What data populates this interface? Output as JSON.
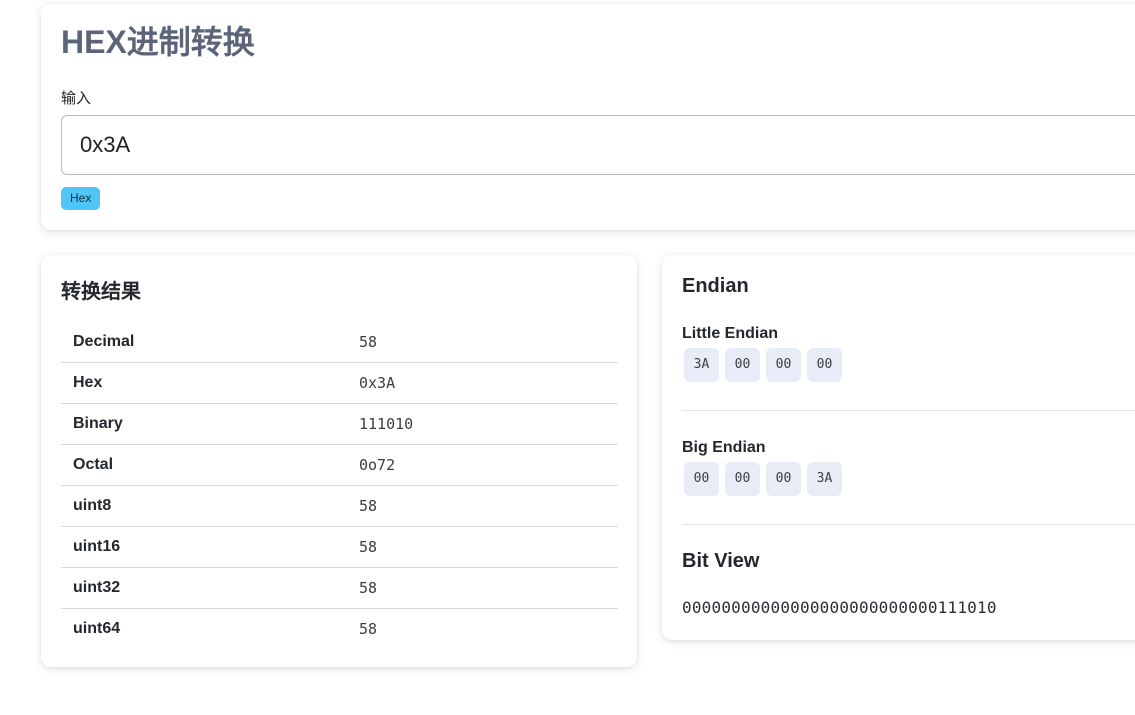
{
  "header": {
    "title": "HEX进制转换",
    "input_label": "输入",
    "input_value": "0x3A",
    "badge": "Hex"
  },
  "results": {
    "title": "转换结果",
    "rows": [
      {
        "key": "Decimal",
        "value": "58"
      },
      {
        "key": "Hex",
        "value": "0x3A"
      },
      {
        "key": "Binary",
        "value": "111010"
      },
      {
        "key": "Octal",
        "value": "0o72"
      },
      {
        "key": "uint8",
        "value": "58"
      },
      {
        "key": "uint16",
        "value": "58"
      },
      {
        "key": "uint32",
        "value": "58"
      },
      {
        "key": "uint64",
        "value": "58"
      }
    ]
  },
  "endian": {
    "title": "Endian",
    "little_label": "Little Endian",
    "little_bytes": [
      "3A",
      "00",
      "00",
      "00"
    ],
    "big_label": "Big Endian",
    "big_bytes": [
      "00",
      "00",
      "00",
      "3A"
    ],
    "bitview_title": "Bit View",
    "bit_string": "00000000000000000000000000111010"
  },
  "colors": {
    "title": "#5b6478",
    "badge": "#4fc6f5",
    "byte_bg": "#e8ecf6"
  }
}
